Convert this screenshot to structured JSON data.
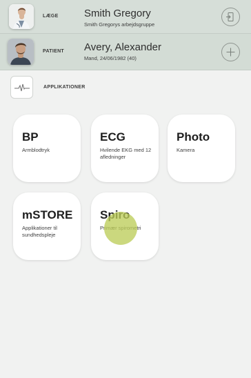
{
  "doctor": {
    "role_label": "LÆGE",
    "name": "Smith Gregory",
    "group": "Smith Gregorys arbejdsgruppe",
    "action_icon": "logout-icon"
  },
  "patient": {
    "role_label": "PATIENT",
    "name": "Avery, Alexander",
    "details": "Mand, 24/06/1982 (40)",
    "action_icon": "add-icon"
  },
  "apps_section": {
    "label": "APPLIKATIONER",
    "icon": "waveform-icon"
  },
  "tiles": [
    {
      "title": "BP",
      "desc": "Armblodtryk"
    },
    {
      "title": "ECG",
      "desc": "Hvilende EKG med 12 afledninger"
    },
    {
      "title": "Photo",
      "desc": "Kamera"
    },
    {
      "title": "mSTORE",
      "desc": "Applikationer til sundhedspleje"
    },
    {
      "title": "Spiro",
      "desc": "Primær spirometri"
    }
  ],
  "colors": {
    "header_bg": "#d6ded8",
    "page_bg": "#f1f2f1",
    "touch_indicator": "#bccd5a"
  }
}
